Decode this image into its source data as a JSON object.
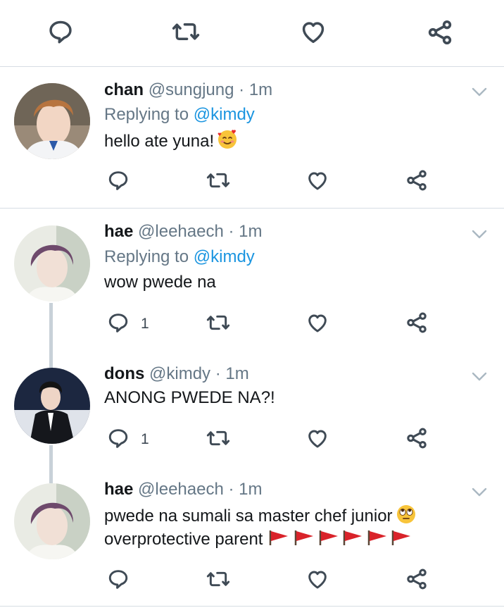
{
  "tweets": [
    {
      "name": "chan",
      "handle": "@sungjung",
      "sep": "·",
      "time": "1m",
      "replying_prefix": "Replying to",
      "replying_to": "@kimdy",
      "text": "hello ate yuna!",
      "reply_count": ""
    },
    {
      "name": "hae",
      "handle": "@leehaech",
      "sep": "·",
      "time": "1m",
      "replying_prefix": "Replying to",
      "replying_to": "@kimdy",
      "text": "wow pwede na",
      "reply_count": "1"
    },
    {
      "name": "dons",
      "handle": "@kimdy",
      "sep": "·",
      "time": "1m",
      "text": "ANONG PWEDE NA?!",
      "reply_count": "1"
    },
    {
      "name": "hae",
      "handle": "@leehaech",
      "sep": "·",
      "time": "1m",
      "text_line1": "pwede na sumali sa master chef junior",
      "text_line2": "overprotective parent",
      "reply_count": ""
    }
  ],
  "colors": {
    "name": "#14171a",
    "meta": "#657786",
    "mention": "#1b95e0",
    "icon": "#3f4a55",
    "divider": "#d6dde3",
    "thread": "#c8d1d8"
  },
  "icons": [
    "reply-icon",
    "retweet-icon",
    "like-icon",
    "share-icon",
    "chevron-down-icon"
  ]
}
